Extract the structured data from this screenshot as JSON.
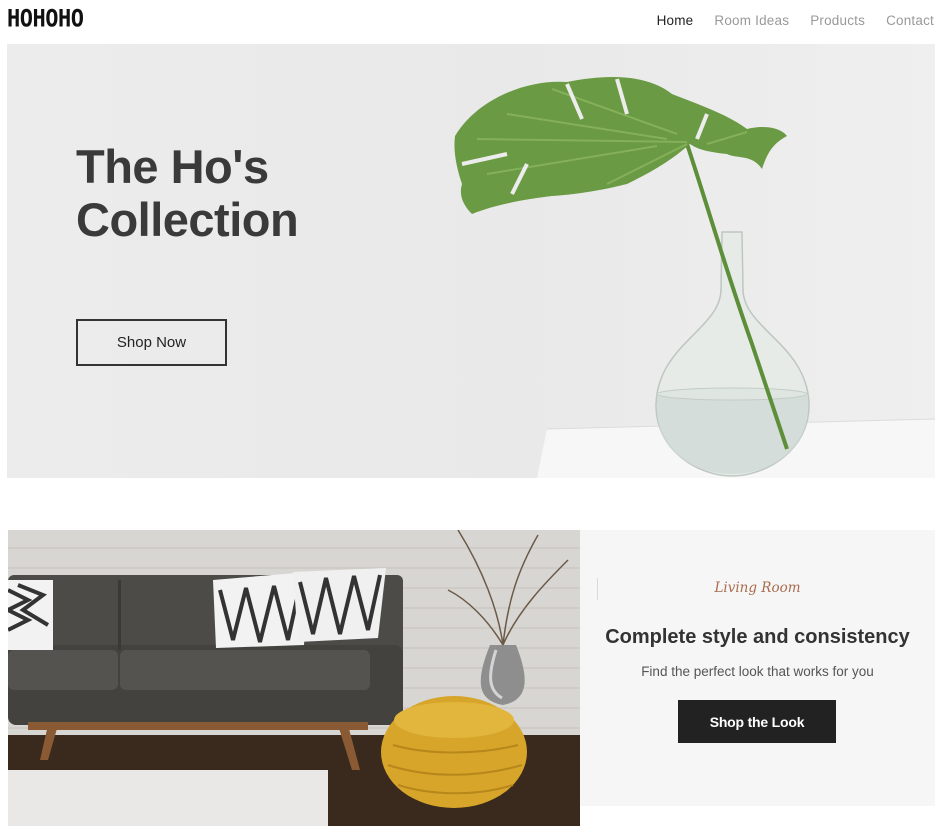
{
  "header": {
    "logo": "HOHOHO",
    "nav": [
      {
        "label": "Home",
        "active": true
      },
      {
        "label": "Room Ideas",
        "active": false
      },
      {
        "label": "Products",
        "active": false
      },
      {
        "label": "Contact",
        "active": false
      }
    ]
  },
  "hero": {
    "title_line1": "The Ho's",
    "title_line2": "Collection",
    "cta_label": "Shop Now",
    "image_icon": "monstera-leaf-in-glass-vase"
  },
  "living_room": {
    "image_icon": "sofa-living-room-photo",
    "kicker": "Living Room",
    "title": "Complete style and consistency",
    "subtitle": "Find the perfect look that works for you",
    "cta_label": "Shop the Look"
  },
  "colors": {
    "accent_kicker": "#a86c4e",
    "button_dark": "#222222",
    "panel_bg": "#f6f6f6"
  }
}
